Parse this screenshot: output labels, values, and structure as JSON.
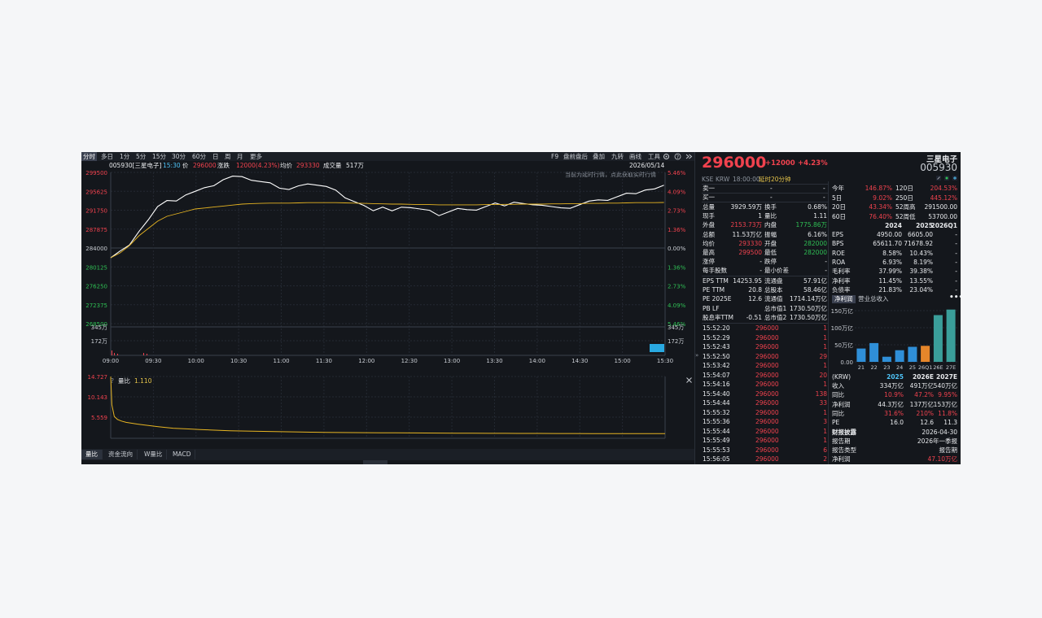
{
  "toolbar": {
    "periods": [
      "分时",
      "多日",
      "1分",
      "5分",
      "15分",
      "30分",
      "60分",
      "日",
      "周",
      "月",
      "更多"
    ],
    "tools": [
      "F9",
      "盘前盘后",
      "叠加",
      "九转",
      "画线",
      "工具"
    ]
  },
  "info": {
    "code_name": "005930[三星电子]",
    "time": "15:30",
    "price_label": "价",
    "price": "296000",
    "change_label": "涨跌",
    "change": "12000(4.23%)",
    "avg_label": "均价",
    "avg": "293330",
    "volume_label": "成交量",
    "volume": "517万",
    "date": "2026/05/14",
    "notice": "当前为延时行情，点此获取实时行情"
  },
  "chart_data": {
    "type": "line",
    "title": "",
    "price_ticks_left": [
      "299500",
      "295625",
      "291750",
      "287875",
      "284000",
      "280125",
      "276250",
      "272375",
      "268500"
    ],
    "pct_ticks_right": [
      "5.46%",
      "4.09%",
      "2.73%",
      "1.36%",
      "0.00%",
      "1.36%",
      "2.73%",
      "4.09%",
      "5.46%"
    ],
    "volume_ticks_left": [
      "345万",
      "172万"
    ],
    "volume_ticks_right": [
      "345万",
      "172万"
    ],
    "time_ticks": [
      "09:00",
      "09:30",
      "10:00",
      "10:30",
      "11:00",
      "11:30",
      "12:00",
      "12:30",
      "13:00",
      "13:30",
      "14:00",
      "14:30",
      "15:00",
      "15:30"
    ],
    "ylim": [
      268500,
      299500
    ],
    "prev_close": 284000,
    "series": [
      {
        "values": [
          282000,
          283500,
          284500,
          287000,
          290000,
          292500,
          293500,
          294000,
          295000,
          295500,
          296000,
          297000,
          298000,
          298500,
          299000,
          298000,
          297500,
          297000,
          296500,
          296000,
          296500,
          297500,
          297000,
          296500,
          295500,
          294500,
          293500,
          292500,
          292000,
          292500,
          291500,
          292000,
          292500,
          292000,
          291500,
          291000,
          291500,
          292000,
          291500,
          292000,
          292500,
          293000,
          293000,
          293500,
          293000,
          292500,
          293000,
          292500,
          292000,
          292500,
          293000,
          293500,
          293500,
          294000,
          294500,
          295000,
          295500,
          296000,
          296000,
          296500
        ]
      },
      {
        "values": [
          282000,
          283000,
          284500,
          286500,
          288000,
          289500,
          290500,
          291000,
          291500,
          292000,
          292200,
          292400,
          292600,
          292800,
          293000,
          293100,
          293150,
          293200,
          293200,
          293200,
          293250,
          293300,
          293300,
          293300,
          293300,
          293250,
          293200,
          293150,
          293100,
          293050,
          293000,
          293000,
          292950,
          292900,
          292900,
          292850,
          292850,
          292850,
          292850,
          292850,
          292900,
          292900,
          292950,
          292950,
          293000,
          293000,
          293000,
          293050,
          293050,
          293100,
          293100,
          293150,
          293150,
          293200,
          293200,
          293250,
          293300,
          293300,
          293300,
          293330
        ]
      }
    ]
  },
  "ratio_chart": {
    "title": "量比",
    "value": "1.110",
    "ticks": [
      "14.727",
      "10.143",
      "5.559"
    ],
    "values": [
      14.7,
      8,
      5.2,
      4.5,
      4.1,
      3.8,
      3.6,
      3.4,
      3.2,
      3.0,
      2.8,
      2.6,
      2.4,
      2.3,
      2.2,
      2.1,
      2.0,
      1.9,
      1.8,
      1.75,
      1.7,
      1.65,
      1.6,
      1.55,
      1.5,
      1.45,
      1.4,
      1.38,
      1.36,
      1.34,
      1.32,
      1.3,
      1.28,
      1.26,
      1.24,
      1.22,
      1.2,
      1.19,
      1.18,
      1.17,
      1.16,
      1.15,
      1.14,
      1.13,
      1.12,
      1.115,
      1.112,
      1.11
    ],
    "ylim": [
      0,
      14.727
    ]
  },
  "bottom_tabs": [
    "量比",
    "资金流向",
    "W量比",
    "MACD"
  ],
  "quote": {
    "price": "296000",
    "change": "+12000",
    "pct": "+4.23%",
    "exchange": "KSE",
    "currency": "KRW",
    "time": "18:00:00",
    "delay": "延时20分钟",
    "name": "三星电子",
    "code": "005930",
    "sell1_label": "卖一",
    "sell1": "-",
    "sell1_vol": "-",
    "buy1_label": "买一",
    "buy1": "-",
    "buy1_vol": "-"
  },
  "stats": [
    [
      "总量",
      "3929.59万",
      "换手",
      "0.68%"
    ],
    [
      "现手",
      "1",
      "量比",
      "1.11"
    ],
    [
      "外盘",
      "2153.73万",
      "内盘",
      "1775.86万"
    ],
    [
      "总额",
      "11.53万亿",
      "振幅",
      "6.16%"
    ],
    [
      "均价",
      "293330",
      "开盘",
      "282000"
    ],
    [
      "最高",
      "299500",
      "最低",
      "282000"
    ],
    [
      "涨停",
      "-",
      "跌停",
      "-"
    ],
    [
      "每手股数",
      "-",
      "最小价差",
      "-"
    ]
  ],
  "valuation": [
    [
      "EPS TTM",
      "14253.95",
      "流通盘",
      "57.91亿"
    ],
    [
      "PE TTM",
      "20.8",
      "总股本",
      "58.46亿"
    ],
    [
      "PE 2025E",
      "12.6",
      "流通值",
      "1714.14万亿"
    ],
    [
      "PB LF",
      "",
      "总市值1",
      "1730.50万亿"
    ],
    [
      "股息率TTM",
      "-0.51",
      "总市值2",
      "1730.50万亿"
    ]
  ],
  "ticks": [
    [
      "15:52:20",
      "296000",
      "1"
    ],
    [
      "15:52:29",
      "296000",
      "1"
    ],
    [
      "15:52:43",
      "296000",
      "1"
    ],
    [
      "15:52:50",
      "296000",
      "29"
    ],
    [
      "15:53:42",
      "296000",
      "1"
    ],
    [
      "15:54:07",
      "296000",
      "20"
    ],
    [
      "15:54:16",
      "296000",
      "1"
    ],
    [
      "15:54:40",
      "296000",
      "138"
    ],
    [
      "15:54:44",
      "296000",
      "33"
    ],
    [
      "15:55:32",
      "296000",
      "1"
    ],
    [
      "15:55:36",
      "296000",
      "3"
    ],
    [
      "15:55:44",
      "296000",
      "1"
    ],
    [
      "15:55:49",
      "296000",
      "1"
    ],
    [
      "15:55:53",
      "296000",
      "6"
    ],
    [
      "15:56:05",
      "296000",
      "2"
    ]
  ],
  "performance": [
    [
      "今年",
      "146.87%",
      "120日",
      "204.53%"
    ],
    [
      "5日",
      "9.02%",
      "250日",
      "445.12%"
    ],
    [
      "20日",
      "43.34%",
      "52周高",
      "291500.00"
    ],
    [
      "60日",
      "76.40%",
      "52周低",
      "53700.00"
    ]
  ],
  "fin_header": [
    "",
    "2024",
    "2025",
    "2026Q1"
  ],
  "fin_rows": [
    [
      "EPS",
      "4950.00",
      "6605.00",
      "-"
    ],
    [
      "BPS",
      "65611.70",
      "71678.92",
      "-"
    ],
    [
      "ROE",
      "8.58%",
      "10.43%",
      "-"
    ],
    [
      "ROA",
      "6.93%",
      "8.19%",
      "-"
    ],
    [
      "毛利率",
      "37.99%",
      "39.38%",
      "-"
    ],
    [
      "净利率",
      "11.45%",
      "13.55%",
      "-"
    ],
    [
      "负债率",
      "21.83%",
      "23.04%",
      "-"
    ]
  ],
  "bar_chart": {
    "type": "bar",
    "tabs": [
      "净利润",
      "营业总收入"
    ],
    "ticks": [
      "150万亿",
      "100万亿",
      "50万亿",
      "0.00"
    ],
    "categories": [
      "21",
      "22",
      "23",
      "24",
      "25",
      "26Q1",
      "26E",
      "27E"
    ],
    "values": [
      39,
      55,
      15,
      34,
      44,
      47,
      137,
      153
    ],
    "ylim": [
      0,
      150
    ]
  },
  "forecast_header": [
    "(KRW)",
    "2025",
    "2026E",
    "2027E"
  ],
  "forecast_rows": [
    [
      "收入",
      "334万亿",
      "491万亿",
      "540万亿"
    ],
    [
      "同比",
      "10.9%",
      "47.2%",
      "9.95%"
    ],
    [
      "净利润",
      "44.3万亿",
      "137万亿",
      "153万亿"
    ],
    [
      "同比",
      "31.6%",
      "210%",
      "11.8%"
    ],
    [
      "PE",
      "16.0",
      "12.6",
      "11.3"
    ]
  ],
  "report": {
    "title": "财报披露",
    "date": "2026-04-30",
    "period_label": "报告期",
    "period": "2026年一季报",
    "type_label": "报告类型",
    "type": "报告期",
    "profit_label": "净利润",
    "profit": "47.10万亿"
  },
  "colors": {
    "up": "#f0424e",
    "down": "#2fbf54",
    "price_line": "#ffffff",
    "avg_line": "#e6b422",
    "bg": "#14171c"
  }
}
